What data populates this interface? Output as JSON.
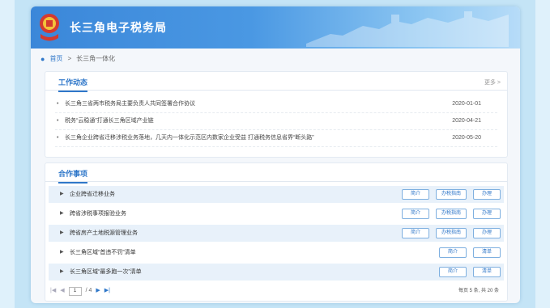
{
  "header": {
    "title": "长三角电子税务局"
  },
  "breadcrumb": {
    "home": "首页",
    "separator": ">",
    "current": "长三角一体化"
  },
  "news_section": {
    "title": "工作动态",
    "more": "更多 >",
    "items": [
      {
        "text": "长三角三省两市税务局主要负责人共同签署合作协议",
        "date": "2020-01-01"
      },
      {
        "text": "税务“云稳通”打通长三角区域产业链",
        "date": "2020-04-21"
      },
      {
        "text": "长三角企业跨省迁移涉税业务落地，几天内一体化示范区内数家企业受益 打通税务信息省界“断头路”",
        "date": "2020-05-20"
      }
    ]
  },
  "coop_section": {
    "title": "合作事项",
    "items": [
      {
        "label": "企业跨省迁移业务",
        "buttons": [
          "简介",
          "办税指南",
          "办理"
        ]
      },
      {
        "label": "跨省涉税事项报验业务",
        "buttons": [
          "简介",
          "办税指南",
          "办理"
        ]
      },
      {
        "label": "跨省房产土地税源管理业务",
        "buttons": [
          "简介",
          "办税指南",
          "办理"
        ]
      },
      {
        "label": "长三角区域“首违不罚”清单",
        "buttons": [
          "简介",
          "清单"
        ]
      },
      {
        "label": "长三角区域“最多跑一次”清单",
        "buttons": [
          "简介",
          "清单"
        ]
      }
    ]
  },
  "pager": {
    "current": "1",
    "total_label": "/ 4",
    "summary": "每页 5 条, 共 20 条"
  },
  "colors": {
    "accent": "#2f77c9",
    "banner": "#3b87d9",
    "row_shade": "#e8f1fa"
  }
}
